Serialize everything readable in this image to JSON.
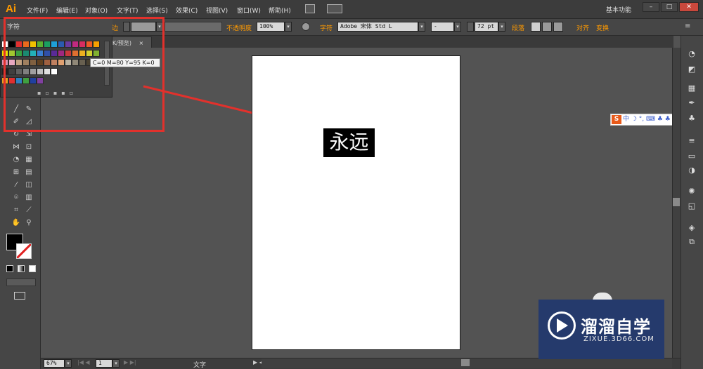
{
  "app": {
    "logo": "Ai",
    "workspace": "基本功能"
  },
  "menu": [
    "文件(F)",
    "编辑(E)",
    "对象(O)",
    "文字(T)",
    "选择(S)",
    "效果(C)",
    "视图(V)",
    "窗口(W)",
    "帮助(H)"
  ],
  "window_controls": {
    "minimize": "–",
    "maximize": "□",
    "close": "✕"
  },
  "control_bar": {
    "panel_label": "字符",
    "stroke_label": "描边",
    "opacity_label": "不透明度",
    "opacity_value": "100%",
    "char_label": "字符",
    "font_family": "Adobe 宋体 Std L",
    "font_style": "-",
    "font_size": "72 pt",
    "paragraph_label": "段落",
    "align_label": "对齐",
    "transform_label": "变换"
  },
  "document_tab": {
    "label": "YK/预览)",
    "close": "×"
  },
  "swatch_popup": {
    "title": "字符",
    "tooltip": "C=0 M=80 Y=95 K=0",
    "row1": [
      "#ffffff",
      "#000000",
      "#e03030",
      "#e96a1c",
      "#f0c000",
      "#5cb030",
      "#1aa060",
      "#1ea0d8",
      "#2a5bb0",
      "#6a3aa0",
      "#c02a80",
      "#d82d60",
      "#ee5a28",
      "#f6a000"
    ],
    "row2": [
      "#e8e000",
      "#a0c830",
      "#3aa040",
      "#1a8a70",
      "#22b0b8",
      "#3a7ed0",
      "#3050a8",
      "#5a2a98",
      "#a02880",
      "#c8383c",
      "#e07030",
      "#ecb020",
      "#d0d030",
      "#80b030"
    ],
    "row3": [
      "#d890b0",
      "#e8a8c0",
      "#c0a080",
      "#a08060",
      "#806040",
      "#604020",
      "#a06040",
      "#c08060",
      "#e0a070",
      "#b8b0a0",
      "#908878",
      "#686050",
      "#484030",
      "#303020"
    ],
    "row4": [
      "#202020",
      "#404040",
      "#606060",
      "#808080",
      "#a0a0a0",
      "#c0c0c0",
      "#e0e0e0",
      "#ffffff"
    ],
    "row5": [
      "#e8a020",
      "#e03030",
      "#3080c0",
      "#40a040",
      "#2040a0",
      "#8040a0"
    ]
  },
  "canvas": {
    "text": "永远"
  },
  "ime": {
    "label": "中 ☽ °, ⌨ ♣ ♣ 👕 ✎"
  },
  "status": {
    "zoom": "67%",
    "page": "1",
    "tool": "文字"
  },
  "watermark": {
    "title": "溜溜自学",
    "subtitle": "ZIXUE.3D66.COM"
  },
  "colors": {
    "accent": "#ff9a00",
    "highlight": "#e2312c",
    "watermark_bg": "#253a6c"
  }
}
